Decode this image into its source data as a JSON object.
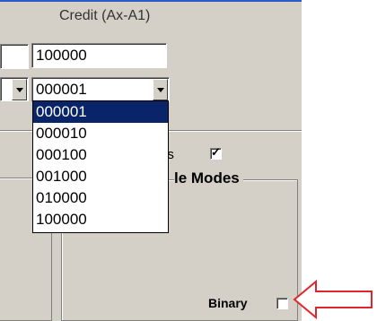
{
  "header": {
    "credit_label": "Credit (Ax-A1)"
  },
  "credit_field": {
    "value": "100000"
  },
  "select": {
    "value": "000001",
    "options": [
      "000001",
      "000010",
      "000100",
      "001000",
      "010000",
      "100000"
    ],
    "selected_index": 0
  },
  "partial_label": "es",
  "checkbox_partial": {
    "checked": true
  },
  "group": {
    "title": "le Modes"
  },
  "binary": {
    "label": "Binary",
    "checked": false
  },
  "colors": {
    "highlight": "#0a246a",
    "arrow": "#e0262a",
    "panel": "#d4d0c8"
  },
  "icons": {
    "arrow": "red-arrow-left-icon"
  }
}
